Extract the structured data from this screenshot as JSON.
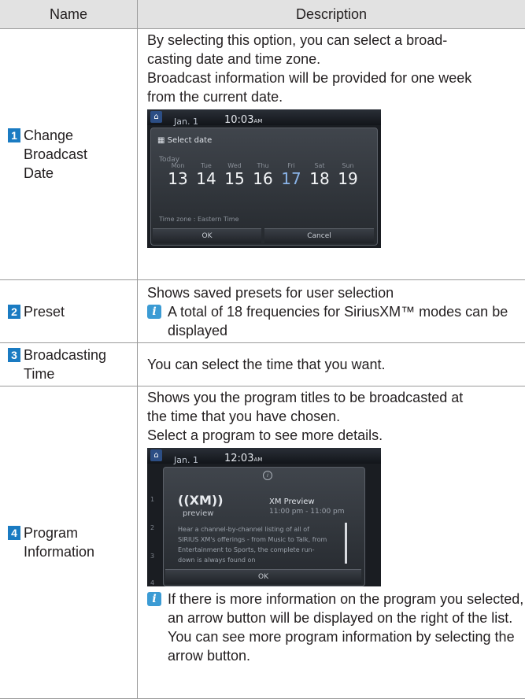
{
  "table": {
    "headers": {
      "name": "Name",
      "description": "Description"
    },
    "rows": {
      "r1": {
        "num": "1",
        "name": "Change Broadcast Date",
        "lines": [
          "By selecting this option, you can select a broad-",
          "casting date and time zone.",
          "Broadcast information will be provided for one week",
          "from the current date."
        ],
        "screen": {
          "home": "⌂",
          "date": "Jan.  1",
          "time": "10:03",
          "ampm": "AM",
          "dialog_title": "Select date",
          "today": "Today",
          "days": [
            {
              "name": "Mon",
              "num": "13"
            },
            {
              "name": "Tue",
              "num": "14"
            },
            {
              "name": "Wed",
              "num": "15"
            },
            {
              "name": "Thu",
              "num": "16"
            },
            {
              "name": "Fri",
              "num": "17"
            },
            {
              "name": "Sat",
              "num": "18"
            },
            {
              "name": "Sun",
              "num": "19"
            }
          ],
          "selected_day_index": 4,
          "timezone": "Time zone : Eastern Time",
          "ok": "OK",
          "cancel": "Cancel"
        }
      },
      "r2": {
        "num": "2",
        "name": "Preset",
        "lines": [
          "Shows saved presets for user selection"
        ],
        "note_icon": "i",
        "note": "A total of 18 frequencies for SiriusXM™ modes can be displayed"
      },
      "r3": {
        "num": "3",
        "name": "Broadcasting Time",
        "lines": [
          "You can select the time that you want."
        ]
      },
      "r4": {
        "num": "4",
        "name": "Program Information",
        "lines": [
          "Shows you the program titles to be broadcasted at",
          "the time that you have chosen.",
          "Select a program to see more details."
        ],
        "screen": {
          "home": "⌂",
          "date": "Jan.  1",
          "time": "12:03",
          "ampm": "AM",
          "info": "i",
          "logo": "((XM))",
          "logo_sub": "preview",
          "program_title": "XM Preview",
          "program_time": "11:00 pm - 11:00 pm",
          "body": "Hear a channel-by-channel listing of all of SIRIUS XM's offerings - from Music to Talk, from Entertainment to Sports, the complete run-down is always found on",
          "ok": "OK",
          "side_numbers": [
            "1",
            "2",
            "3",
            "4"
          ]
        },
        "note_icon": "i",
        "note": "If there is more information on the program you selected, an arrow button will be displayed on the right of the list. You can see more program information by selecting the arrow button."
      }
    }
  }
}
